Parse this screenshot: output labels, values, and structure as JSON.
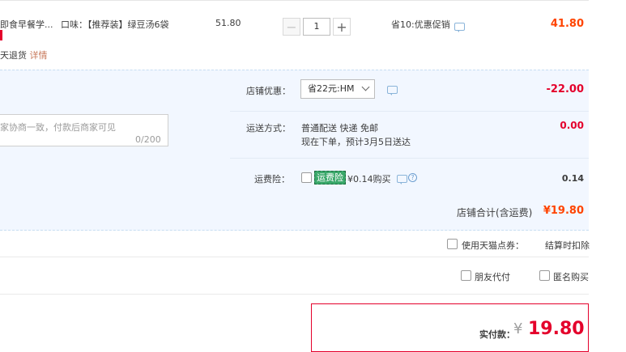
{
  "product": {
    "name": "即食早餐学...",
    "flavor": "口味：【推荐装】绿豆汤6袋",
    "refund_prefix": "天退货",
    "detail_link": "详情",
    "price": "51.80",
    "quantity": "1",
    "promotion": "省10:优惠促销",
    "subtotal": "41.80"
  },
  "message": {
    "placeholder": "家协商一致，付款后商家可见",
    "counter": "0/200"
  },
  "shop_discount": {
    "label": "店铺优惠：",
    "selected": "省22元:HM",
    "amount": "-22.00"
  },
  "shipping": {
    "label": "运送方式：",
    "method": "普通配送 快递 免邮",
    "estimate": "现在下单，预计3月5日送达",
    "amount": "0.00"
  },
  "insurance": {
    "label": "运费险：",
    "tag": "运费险",
    "price_text": "¥0.14购买",
    "amount": "0.14"
  },
  "shop_total": {
    "label": "店铺合计(含运费)",
    "amount": "¥19.80"
  },
  "coupon": {
    "label": "使用天猫点券：",
    "note": "结算时扣除"
  },
  "friend_pay": {
    "label": "朋友代付"
  },
  "anonymous": {
    "label": "匿名购买"
  },
  "payment": {
    "label": "实付款：",
    "currency": "¥",
    "amount": "19.80"
  },
  "colors": {
    "accent_red": "#e4002b",
    "price_orange": "#ff4400",
    "panel_blue": "#f2f7ff"
  }
}
